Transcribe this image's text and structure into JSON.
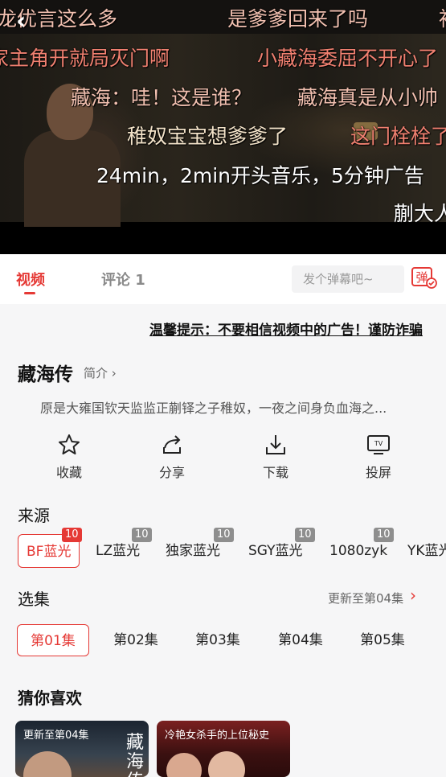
{
  "danmaku": [
    {
      "text": "龙优言这么多",
      "color": "#f2c0b0"
    },
    {
      "text": "是爹爹回来了吗",
      "color": "#f2c0b0"
    },
    {
      "text": "裕",
      "color": "#f2c0b0"
    },
    {
      "text": "家主角开就局灭门啊",
      "color": "#f08070"
    },
    {
      "text": "小藏海委屈不开心了",
      "color": "#f08070"
    },
    {
      "text": "藏海：哇！这是谁？",
      "color": "#f2c0b0"
    },
    {
      "text": "藏海真是从小帅",
      "color": "#f2c0b0"
    },
    {
      "text": "稚奴宝宝想爹爹了",
      "color": "#f2e2c8"
    },
    {
      "text": "这门栓栓了",
      "color": "#f08070"
    },
    {
      "text": "24min，2min开头音乐，5分钟广告",
      "color": "#ffffff"
    },
    {
      "text": "蒯大人",
      "color": "#ffffff"
    }
  ],
  "player": {
    "back_glyph": "‹"
  },
  "tabs": {
    "video": "视频",
    "comment": "评论 1"
  },
  "danmaku_input": {
    "placeholder": "发个弹幕吧~",
    "toggle_label": "弹"
  },
  "notice": "温馨提示：不要相信视频中的广告！谨防诈骗",
  "show": {
    "title": "藏海传",
    "intro_link": "简介 ›",
    "description": "原是大雍国钦天监监正蒯铎之子稚奴，一夜之间身负血海之..."
  },
  "actions": [
    {
      "label": "收藏",
      "icon": "star-icon"
    },
    {
      "label": "分享",
      "icon": "share-icon"
    },
    {
      "label": "下载",
      "icon": "download-icon"
    },
    {
      "label": "投屏",
      "icon": "tv-icon"
    }
  ],
  "sources": {
    "title": "来源",
    "items": [
      {
        "label": "BF蓝光",
        "count": "10",
        "active": true
      },
      {
        "label": "LZ蓝光",
        "count": "10"
      },
      {
        "label": "独家蓝光",
        "count": "10"
      },
      {
        "label": "SGY蓝光",
        "count": "10"
      },
      {
        "label": "1080zyk",
        "count": "10"
      },
      {
        "label": "YK蓝光",
        "count": ""
      }
    ]
  },
  "episodes": {
    "title": "选集",
    "update_text": "更新至第04集",
    "items": [
      "第01集",
      "第02集",
      "第03集",
      "第04集",
      "第05集"
    ]
  },
  "recommend": {
    "title": "猜你喜欢",
    "cards": [
      {
        "caption": "更新至第04集",
        "poster_text": "藏海传"
      },
      {
        "caption": "冷艳女杀手的上位秘史"
      }
    ]
  },
  "colors": {
    "accent": "#e53935"
  }
}
